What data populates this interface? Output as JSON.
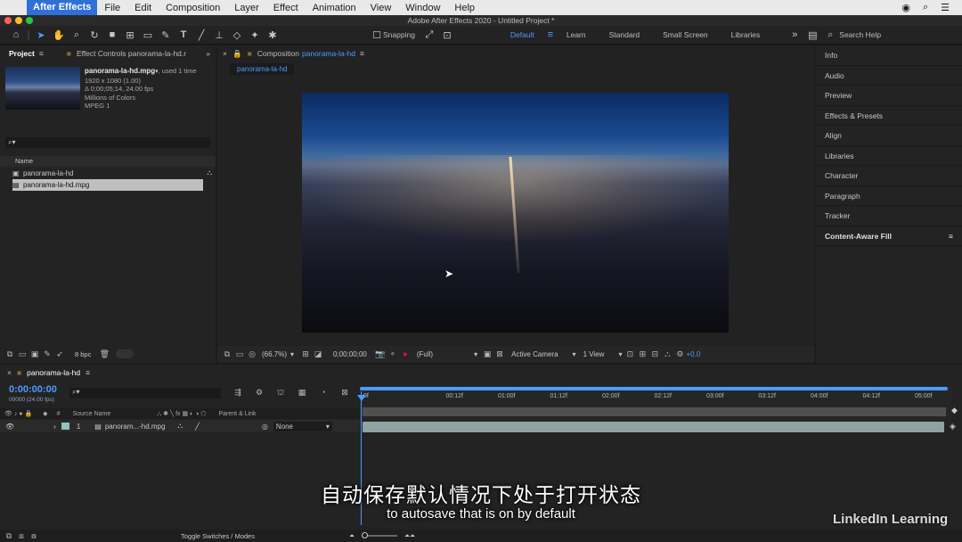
{
  "menubar": {
    "app_name": "After Effects",
    "items": [
      "File",
      "Edit",
      "Composition",
      "Layer",
      "Effect",
      "Animation",
      "View",
      "Window",
      "Help"
    ]
  },
  "window": {
    "title": "Adobe After Effects 2020 - Untitled Project *"
  },
  "toolbar": {
    "snapping_label": "Snapping",
    "workspaces": [
      "Default",
      "Learn",
      "Standard",
      "Small Screen",
      "Libraries"
    ],
    "active_workspace": "Default",
    "search_placeholder": "Search Help"
  },
  "project_panel": {
    "tab_project": "Project",
    "tab_effect_controls": "Effect Controls panorama-la-hd.r",
    "footage_name": "panorama-la-hd.mpg",
    "footage_used": ", used 1 time",
    "footage_dims": "1920 x 1080 (1.00)",
    "footage_duration": "Δ 0;00;05;14, 24.00 fps",
    "footage_colors": "Millions of Colors",
    "footage_codec": "MPEG 1",
    "column_name": "Name",
    "items": [
      {
        "name": "panorama-la-hd",
        "type": "composition"
      },
      {
        "name": "panorama-la-hd.mpg",
        "type": "footage"
      }
    ],
    "bpc": "8 bpc"
  },
  "composition_panel": {
    "tab_prefix": "Composition",
    "tab_name": "panorama-la-hd",
    "flow_tab": "panorama-la-hd",
    "zoom": "(66.7%)",
    "timecode": "0;00;00;00",
    "resolution": "(Full)",
    "camera": "Active Camera",
    "view": "1 View",
    "exposure": "+0.0"
  },
  "right_panels": [
    "Info",
    "Audio",
    "Preview",
    "Effects & Presets",
    "Align",
    "Libraries",
    "Character",
    "Paragraph",
    "Tracker",
    "Content-Aware Fill"
  ],
  "timeline": {
    "tab_name": "panorama-la-hd",
    "current_time": "0:00:00:00",
    "frame_info": "00000 (24.00 fps)",
    "col_hash": "#",
    "col_source_name": "Source Name",
    "col_parent_link": "Parent & Link",
    "ruler_labels": [
      "0f",
      "00:12f",
      "01:00f",
      "01:12f",
      "02:00f",
      "02:12f",
      "03:00f",
      "03:12f",
      "04:00f",
      "04:12f",
      "05:00f",
      "05:12f"
    ],
    "layer": {
      "index": "1",
      "name": "panoram...-hd.mpg",
      "parent": "None"
    },
    "toggle_label": "Toggle Switches / Modes"
  },
  "subtitles": {
    "chinese": "自动保存默认情况下处于打开状态",
    "english": "to autosave that is on by default"
  },
  "watermark": {
    "brand": "LinkedIn Learning"
  },
  "colors": {
    "accent": "#4b9cff",
    "app_highlight": "#2f6fd8",
    "layer_bar": "#8fa3a2"
  }
}
